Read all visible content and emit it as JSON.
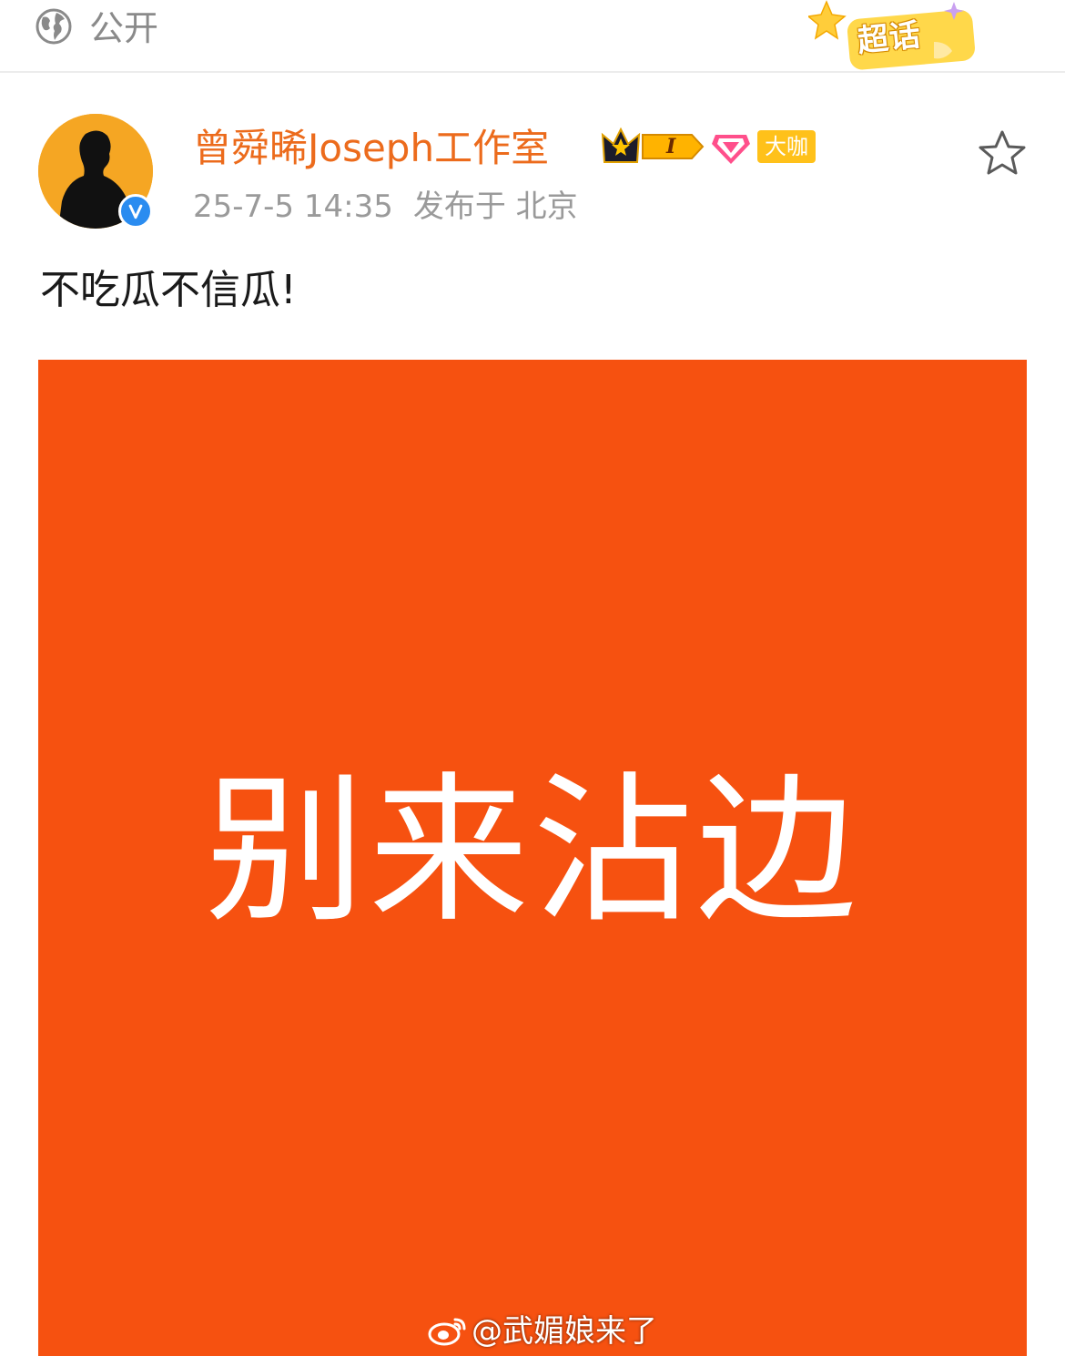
{
  "topbar": {
    "visibility_label": "公开",
    "super_topic_label": "超话"
  },
  "post": {
    "author": "曾舜晞Joseph工作室",
    "level_badge": "I",
    "member_badge": "大咖",
    "date": "25-7-5 14:35",
    "location": "发布于 北京",
    "text": "不吃瓜不信瓜!",
    "image": {
      "caption": "别来沾边",
      "background_color": "#f65110"
    },
    "watermark": "@武媚娘来了"
  },
  "colors": {
    "author": "#ec6b1c",
    "meta": "#9a9a9a",
    "verified": "#2a8cf0",
    "member_badge": "#ffc11a"
  }
}
